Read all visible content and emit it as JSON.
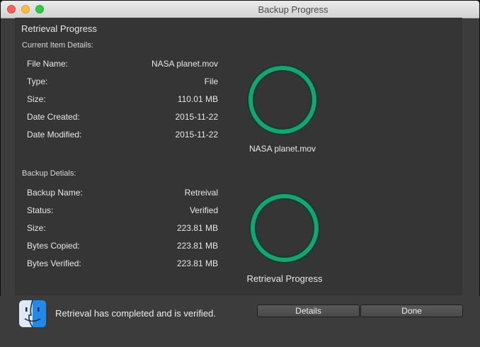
{
  "window": {
    "title": "Backup Progress"
  },
  "heading": "Retrieval Progress",
  "current_item": {
    "section_label": "Current Item Details:",
    "rows": [
      {
        "label": "File Name:",
        "value": "NASA planet.mov"
      },
      {
        "label": "Type:",
        "value": "File"
      },
      {
        "label": "Size:",
        "value": "110.01 MB"
      },
      {
        "label": "Date Created:",
        "value": "2015-11-22"
      },
      {
        "label": "Date Modified:",
        "value": "2015-11-22"
      }
    ],
    "ring_caption": "NASA planet.mov",
    "progress_fraction": 1.0
  },
  "backup": {
    "section_label": "Backup Detials:",
    "rows": [
      {
        "label": "Backup Name:",
        "value": "Retreival"
      },
      {
        "label": "Status:",
        "value": "Verified"
      },
      {
        "label": "Size:",
        "value": "223.81 MB"
      },
      {
        "label": "Bytes Copied:",
        "value": "223.81 MB"
      },
      {
        "label": "Bytes Verified:",
        "value": "223.81 MB"
      }
    ],
    "ring_caption": "Retrieval Progress",
    "progress_fraction": 1.0
  },
  "status_message": "Retrieval has completed and is verified.",
  "buttons": {
    "details": "Details",
    "done": "Done"
  },
  "colors": {
    "ring_track": "#0b3f3a",
    "ring_fill": "#1aa36b",
    "background": "#3c3c3c"
  },
  "icons": {
    "status_icon": "finder-icon"
  }
}
